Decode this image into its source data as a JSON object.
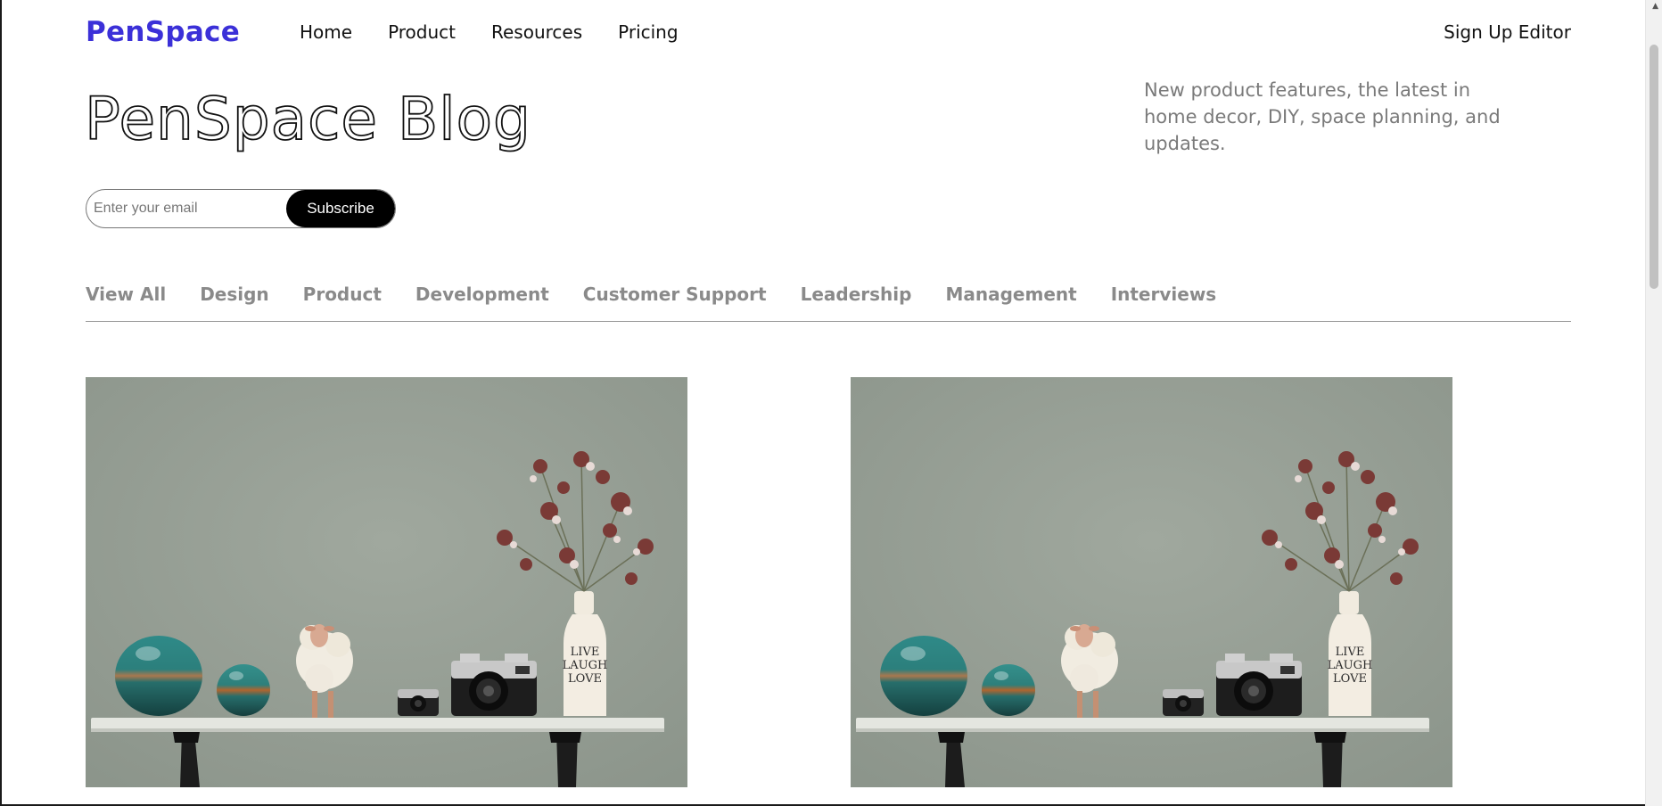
{
  "header": {
    "logo": "PenSpace",
    "nav": [
      "Home",
      "Product",
      "Resources",
      "Pricing"
    ],
    "signup_label": "Sign Up Editor"
  },
  "hero": {
    "title": "PenSpace Blog",
    "description": "New product features, the latest in home decor, DIY, space planning, and updates."
  },
  "subscribe": {
    "placeholder": "Enter your email",
    "button_label": "Subscribe"
  },
  "categories": [
    "View All",
    "Design",
    "Product",
    "Development",
    "Customer Support",
    "Leadership",
    "Management",
    "Interviews"
  ],
  "cards": [
    {
      "vase_text": [
        "LIVE",
        "LAUGH",
        "LOVE"
      ]
    },
    {
      "vase_text": [
        "LIVE",
        "LAUGH",
        "LOVE"
      ]
    }
  ],
  "colors": {
    "brand": "#3b30d8",
    "wall": "#97a096",
    "tab_text": "#8a8a8a",
    "blurb_text": "#7a7a7a"
  }
}
